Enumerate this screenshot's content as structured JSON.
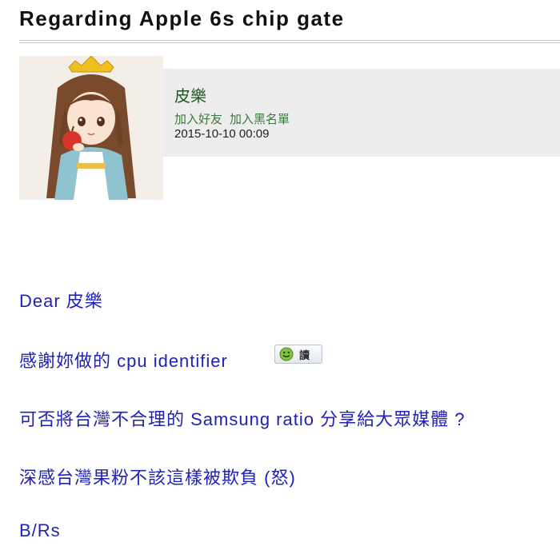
{
  "post": {
    "title": "Regarding Apple 6s chip gate"
  },
  "author": {
    "name": "皮樂",
    "actions": {
      "add_friend": "加入好友",
      "add_blacklist": "加入黑名單"
    },
    "date": "2015-10-10 00:09"
  },
  "body": {
    "lines": [
      "Dear 皮樂",
      "感謝妳做的 cpu identifier",
      "可否將台灣不合理的 Samsung ratio 分享給大眾媒體 ?",
      "深感台灣果粉不該這樣被欺負 (怒)",
      "B/Rs"
    ],
    "read_badge_label": "讀"
  },
  "colors": {
    "body_text": "#2121b8",
    "author_name": "#1c5a1c",
    "panel_bg": "#ededed"
  },
  "icons": {
    "avatar": "anime-girl-avatar",
    "badge": "smiley-face-icon"
  }
}
